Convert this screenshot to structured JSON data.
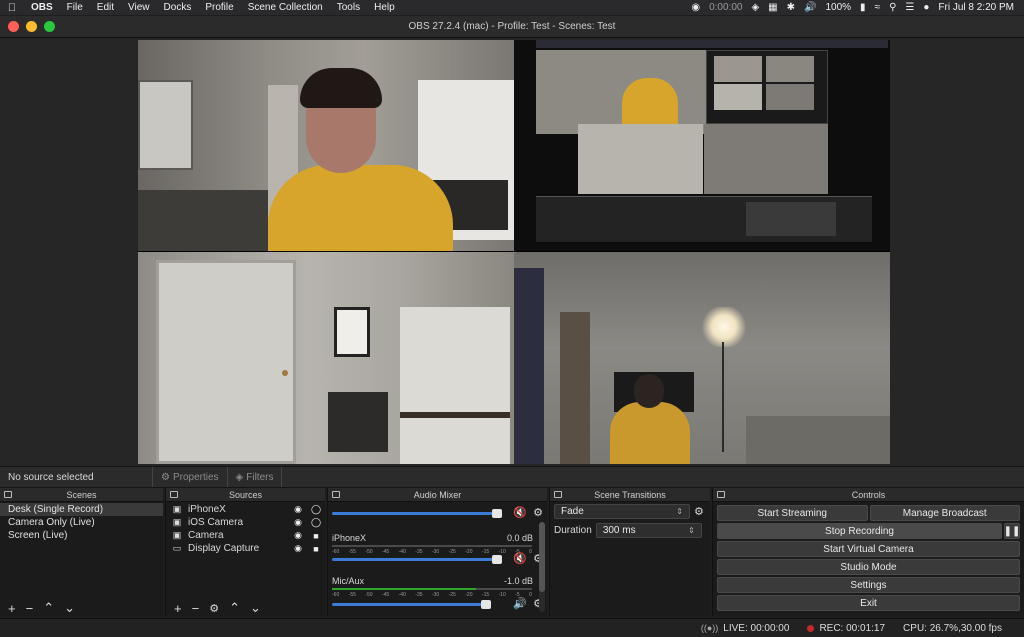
{
  "menubar": {
    "app": "OBS",
    "items": [
      "File",
      "Edit",
      "View",
      "Docks",
      "Profile",
      "Scene Collection",
      "Tools",
      "Help"
    ],
    "timer": "0:00:00",
    "battery": "100%",
    "clock": "Fri Jul 8  2:20 PM"
  },
  "window": {
    "title": "OBS 27.2.4 (mac) - Profile: Test - Scenes: Test"
  },
  "source_bar": {
    "no_source": "No source selected",
    "properties": "Properties",
    "filters": "Filters"
  },
  "scenes": {
    "title": "Scenes",
    "items": [
      "Desk (Single Record)",
      "Camera Only (Live)",
      "Screen (Live)"
    ]
  },
  "sources": {
    "title": "Sources",
    "items": [
      "iPhoneX",
      "iOS Camera",
      "Camera",
      "Display Capture"
    ]
  },
  "mixer": {
    "title": "Audio Mixer",
    "channels": [
      {
        "name": "",
        "db": "",
        "level": 0.92,
        "muted": true
      },
      {
        "name": "iPhoneX",
        "db": "0.0 dB",
        "level": 0.92,
        "muted": true
      },
      {
        "name": "Mic/Aux",
        "db": "-1.0 dB",
        "level": 0.86,
        "muted": false
      }
    ],
    "ticks": [
      "-60",
      "-55",
      "-50",
      "-45",
      "-40",
      "-35",
      "-30",
      "-25",
      "-20",
      "-15",
      "-10",
      "-5",
      "0"
    ]
  },
  "transitions": {
    "title": "Scene Transitions",
    "selected": "Fade",
    "duration_label": "Duration",
    "duration_value": "300 ms"
  },
  "controls": {
    "title": "Controls",
    "start_streaming": "Start Streaming",
    "manage_broadcast": "Manage Broadcast",
    "stop_recording": "Stop Recording",
    "start_virtual_camera": "Start Virtual Camera",
    "studio_mode": "Studio Mode",
    "settings": "Settings",
    "exit": "Exit"
  },
  "status": {
    "live": "LIVE: 00:00:00",
    "rec": "REC: 00:01:17",
    "cpu": "CPU: 26.7%,30.00 fps"
  },
  "colors": {
    "accent_blue": "#3c7bd6",
    "mute_red": "#e03a3a",
    "meter_green": "#2fa52f"
  }
}
